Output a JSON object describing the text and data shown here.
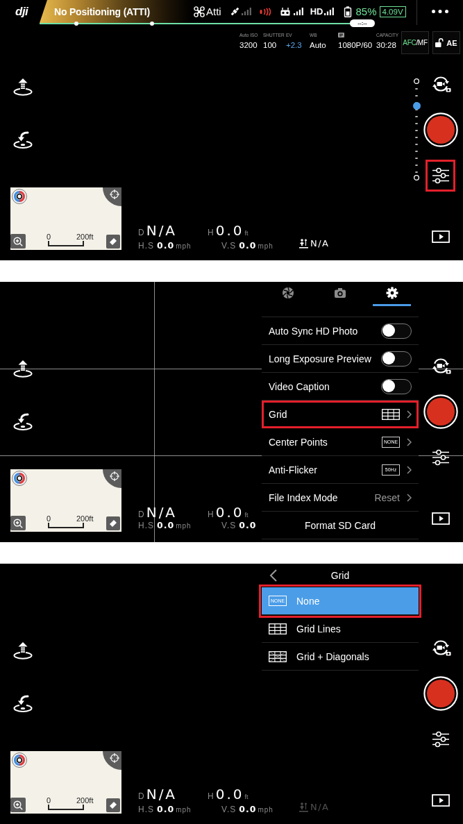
{
  "screens": [
    {
      "status_bar": {
        "logo": "dji",
        "positioning": "No Positioning (ATTI)",
        "timer": "--:--",
        "flight_mode": "Atti",
        "video_link": "HD",
        "battery": "85%",
        "voltage": "4.09V"
      },
      "camera_settings": [
        {
          "kind": "plain",
          "label": "Auto ISO",
          "value": "3200"
        },
        {
          "kind": "plain",
          "label": "SHUTTER",
          "value": "100"
        },
        {
          "kind": "accent",
          "label": "EV",
          "value": "+2.3"
        },
        {
          "kind": "plain",
          "label": "WB",
          "value": "Auto"
        },
        {
          "kind": "icon",
          "value": "1080P/60"
        },
        {
          "kind": "plain",
          "label": "CAPACITY",
          "value": "30:28"
        }
      ],
      "focus_mode": {
        "active": "AFC",
        "other": "/MF"
      },
      "ae_lock": {
        "label": "AE",
        "locked": false
      },
      "slider": {
        "level": 0.73
      },
      "map": {
        "scale_start": "0",
        "scale_end": "200ft"
      },
      "telemetry": {
        "distance": {
          "label": "D",
          "value": "N/A"
        },
        "height": {
          "label": "H",
          "value": "0.0",
          "unit": "ft"
        },
        "horizontal_speed": {
          "label": "H.S",
          "value": "0.0",
          "unit": "mph"
        },
        "vertical_speed": {
          "label": "V.S",
          "value": "0.0",
          "unit": "mph"
        },
        "vision_height": {
          "value": "N/A",
          "dimmed": false
        }
      },
      "settings_button": {
        "highlighted": true
      }
    },
    {
      "grid_overlay": true,
      "map": {
        "scale_start": "0",
        "scale_end": "200ft"
      },
      "telemetry": {
        "distance": {
          "label": "D",
          "value": "N/A"
        },
        "height": {
          "label": "H",
          "value": "0.0",
          "unit": "ft"
        },
        "horizontal_speed": {
          "label": "H.S",
          "value": "0.0",
          "unit": "mph"
        },
        "vertical_speed": {
          "label": "V.S",
          "value": "0.0"
        }
      },
      "settings_button": {
        "highlighted": false
      },
      "settings_menu": {
        "tabs": [
          {
            "kind": "aperture",
            "selected": false
          },
          {
            "kind": "camera",
            "selected": false
          },
          {
            "kind": "gear",
            "selected": true
          }
        ],
        "rows": [
          {
            "kind": "toggle",
            "label": "Auto Sync HD Photo",
            "on": false,
            "highlighted": false
          },
          {
            "kind": "toggle",
            "label": "Long Exposure Preview",
            "on": false,
            "highlighted": false
          },
          {
            "kind": "toggle",
            "label": "Video Caption",
            "on": false,
            "highlighted": false
          },
          {
            "kind": "grid",
            "label": "Grid",
            "highlighted": true
          },
          {
            "kind": "tag",
            "label": "Center Points",
            "tag": "NONE",
            "highlighted": false
          },
          {
            "kind": "tag",
            "label": "Anti-Flicker",
            "tag": "50Hz",
            "highlighted": false
          },
          {
            "kind": "value",
            "label": "File Index Mode",
            "value": "Reset",
            "highlighted": false
          },
          {
            "kind": "action",
            "label": "Format SD Card",
            "highlighted": false
          }
        ]
      }
    },
    {
      "map": {
        "scale_start": "0",
        "scale_end": "200ft"
      },
      "telemetry": {
        "distance": {
          "label": "D",
          "value": "N/A"
        },
        "height": {
          "label": "H",
          "value": "0.0",
          "unit": "ft"
        },
        "horizontal_speed": {
          "label": "H.S",
          "value": "0.0",
          "unit": "mph"
        },
        "vertical_speed": {
          "label": "V.S",
          "value": "0.0",
          "unit": "mph"
        },
        "vision_height": {
          "value": "N/A",
          "dimmed": true
        }
      },
      "settings_button": {
        "highlighted": false
      },
      "grid_menu": {
        "title": "Grid",
        "options": [
          {
            "kind": "none",
            "tag": "NONE",
            "label": "None",
            "selected": true,
            "highlighted": true
          },
          {
            "kind": "lines",
            "label": "Grid Lines",
            "selected": false,
            "highlighted": false
          },
          {
            "kind": "diagonals",
            "label": "Grid + Diagonals",
            "selected": false,
            "highlighted": false
          }
        ]
      }
    }
  ]
}
